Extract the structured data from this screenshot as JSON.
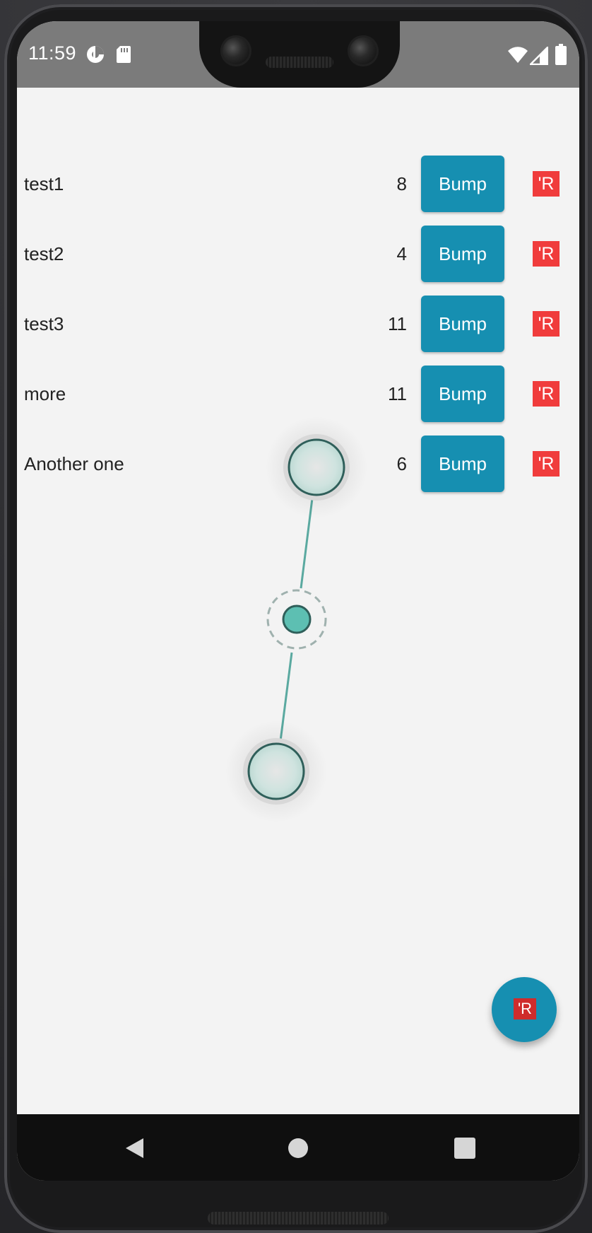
{
  "status_bar": {
    "time": "11:59",
    "icons": [
      "data-saver-icon",
      "sd-card-icon",
      "wifi-icon",
      "cellular-signal-icon",
      "battery-icon"
    ]
  },
  "list": {
    "items": [
      {
        "name": "test1",
        "count": "8",
        "bump_label": "Bump",
        "remove_label": "'R"
      },
      {
        "name": "test2",
        "count": "4",
        "bump_label": "Bump",
        "remove_label": "'R"
      },
      {
        "name": "test3",
        "count": "11",
        "bump_label": "Bump",
        "remove_label": "'R"
      },
      {
        "name": "more",
        "count": "11",
        "bump_label": "Bump",
        "remove_label": "'R"
      },
      {
        "name": "Another one",
        "count": "6",
        "bump_label": "Bump",
        "remove_label": "'R"
      }
    ]
  },
  "fab": {
    "label": "'R"
  },
  "nav_bar": {
    "icons": [
      "back-icon",
      "home-icon",
      "recents-icon"
    ]
  },
  "colors": {
    "accent": "#168fb1",
    "remove": "#f03c3c",
    "fab_label": "#cf2c2c",
    "status_bar": "#7b7b7b",
    "background": "#f3f3f3",
    "gesture_teal": "#5dbfb2"
  }
}
